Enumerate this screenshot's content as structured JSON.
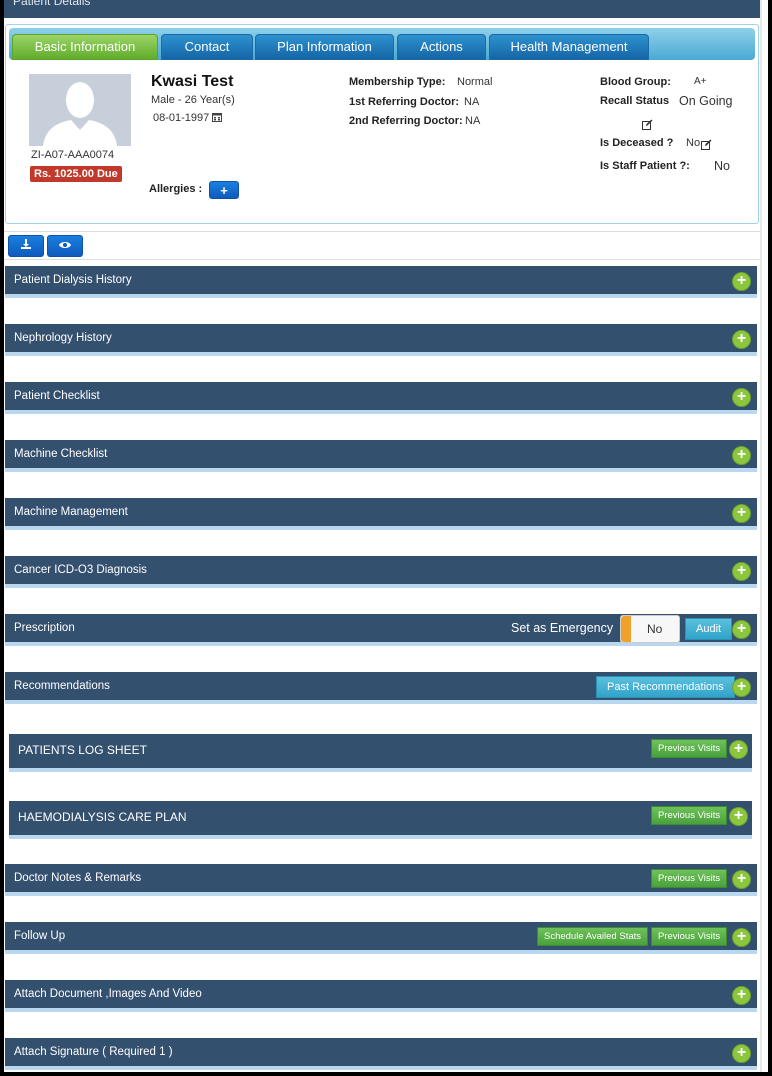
{
  "header": {
    "title": "Patient Details"
  },
  "tabs": [
    {
      "label": "Basic Information"
    },
    {
      "label": "Contact"
    },
    {
      "label": "Plan Information"
    },
    {
      "label": "Actions"
    },
    {
      "label": "Health Management"
    }
  ],
  "patient": {
    "name": "Kwasi Test",
    "gender_age": "Male  -  26 Year(s)",
    "dob": "08-01-1997",
    "id": "ZI-A07-AAA0074",
    "due": "Rs. 1025.00 Due",
    "allergies_label": "Allergies :",
    "membership_label": "Membership Type:",
    "membership_value": "Normal",
    "ref1_label": "1st Referring Doctor:",
    "ref1_value": "NA",
    "ref2_label": "2nd Referring Doctor:",
    "ref2_value": "NA",
    "blood_label": "Blood Group:",
    "blood_value": "A+",
    "recall_label": "Recall Status",
    "recall_value": "On Going",
    "deceased_label": "Is Deceased ?",
    "deceased_value": "No",
    "staff_label": "Is Staff Patient ?:",
    "staff_value": "No"
  },
  "sections": [
    {
      "title": "Patient Dialysis History"
    },
    {
      "title": "Nephrology History"
    },
    {
      "title": "Patient Checklist"
    },
    {
      "title": "Machine Checklist"
    },
    {
      "title": "Machine Management"
    },
    {
      "title": "Cancer ICD-O3 Diagnosis"
    },
    {
      "title": "Prescription",
      "emergency_label": "Set as Emergency",
      "toggle_value": "No",
      "audit_label": "Audit"
    },
    {
      "title": "Recommendations",
      "button": "Past Recommendations"
    },
    {
      "title": "PATIENTS LOG SHEET",
      "button": "Previous Visits"
    },
    {
      "title": "HAEMODIALYSIS CARE PLAN",
      "button": "Previous Visits"
    },
    {
      "title": "Doctor Notes & Remarks",
      "button": "Previous Visits"
    },
    {
      "title": "Follow Up",
      "button1": "Schedule Availed Stats",
      "button2": "Previous Visits"
    },
    {
      "title": "Attach Document ,Images And Video"
    },
    {
      "title": "Attach Signature ( Required 1 )"
    }
  ],
  "icons": {
    "plus": "plus-circle-icon",
    "download": "download-icon",
    "view": "eye-icon",
    "calendar": "calendar-icon",
    "edit": "edit-icon"
  },
  "colors": {
    "section_bg": "#34506f",
    "tab_active": "#60ad2c",
    "tab_inactive": "#1565a6",
    "plus_green": "#8cc63f",
    "due_red": "#c0392b"
  }
}
